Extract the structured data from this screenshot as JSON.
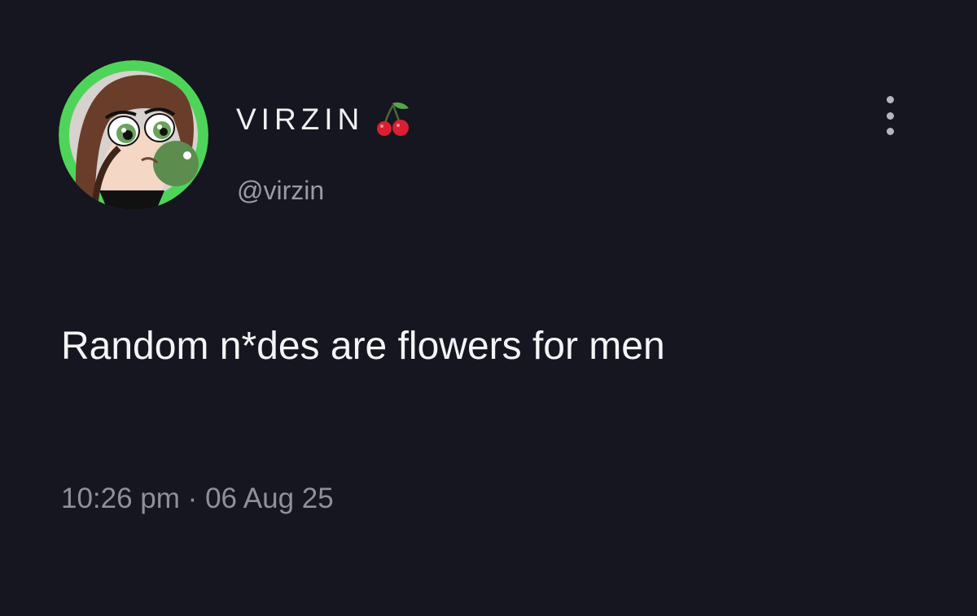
{
  "post": {
    "author": {
      "display_name": "VIRZIN",
      "name_emoji_icon": "cherry-icon",
      "handle": "@virzin",
      "avatar_icon": "cartoon-girl-avatar",
      "avatar_ring_color": "#4fd45a"
    },
    "menu_icon": "more-options-icon",
    "text": "Random n*des are flowers for men",
    "time": "10:26 pm",
    "separator": "·",
    "date": "06 Aug 25"
  },
  "theme": {
    "background": "#15161f",
    "primary_text": "#f4f4f6",
    "secondary_text": "#8f9098"
  }
}
